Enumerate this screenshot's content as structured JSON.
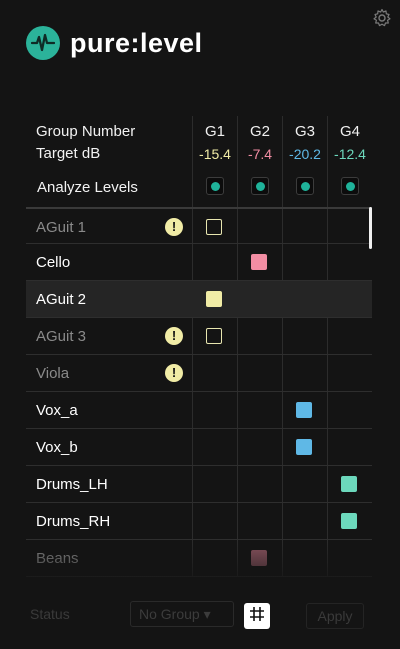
{
  "app": {
    "brand": "pure:level",
    "logo_icon": "waveform-icon",
    "settings_icon": "gear-icon"
  },
  "header": {
    "group_number_label": "Group Number",
    "target_db_label": "Target dB",
    "analyze_label": "Analyze Levels"
  },
  "groups": [
    {
      "label": "G1",
      "target_db": "-15.4",
      "color": "#f1eca6"
    },
    {
      "label": "G2",
      "target_db": "-7.4",
      "color": "#f28da3"
    },
    {
      "label": "G3",
      "target_db": "-20.2",
      "color": "#5fb8e6"
    },
    {
      "label": "G4",
      "target_db": "-12.4",
      "color": "#6cd8bc"
    }
  ],
  "tracks": [
    {
      "name": "AGuit 1",
      "dimmed": true,
      "warning": true,
      "group": "G1",
      "assigned": false
    },
    {
      "name": "Cello",
      "dimmed": false,
      "warning": false,
      "group": "G2",
      "assigned": true
    },
    {
      "name": "AGuit 2",
      "dimmed": false,
      "warning": false,
      "group": "G1",
      "assigned": true,
      "highlighted": true
    },
    {
      "name": "AGuit 3",
      "dimmed": true,
      "warning": true,
      "group": "G1",
      "assigned": false
    },
    {
      "name": "Viola",
      "dimmed": true,
      "warning": true,
      "group": null,
      "assigned": false
    },
    {
      "name": "Vox_a",
      "dimmed": false,
      "warning": false,
      "group": "G3",
      "assigned": true
    },
    {
      "name": "Vox_b",
      "dimmed": false,
      "warning": false,
      "group": "G3",
      "assigned": true
    },
    {
      "name": "Drums_LH",
      "dimmed": false,
      "warning": false,
      "group": "G4",
      "assigned": true
    },
    {
      "name": "Drums_RH",
      "dimmed": false,
      "warning": false,
      "group": "G4",
      "assigned": true
    },
    {
      "name": "Beans",
      "dimmed": true,
      "warning": false,
      "group": "G2",
      "assigned": true
    }
  ],
  "footer": {
    "left_text": "Status",
    "group_select_value": "No Group ▾",
    "grid_icon": "grid-icon",
    "right_text": "Apply"
  }
}
